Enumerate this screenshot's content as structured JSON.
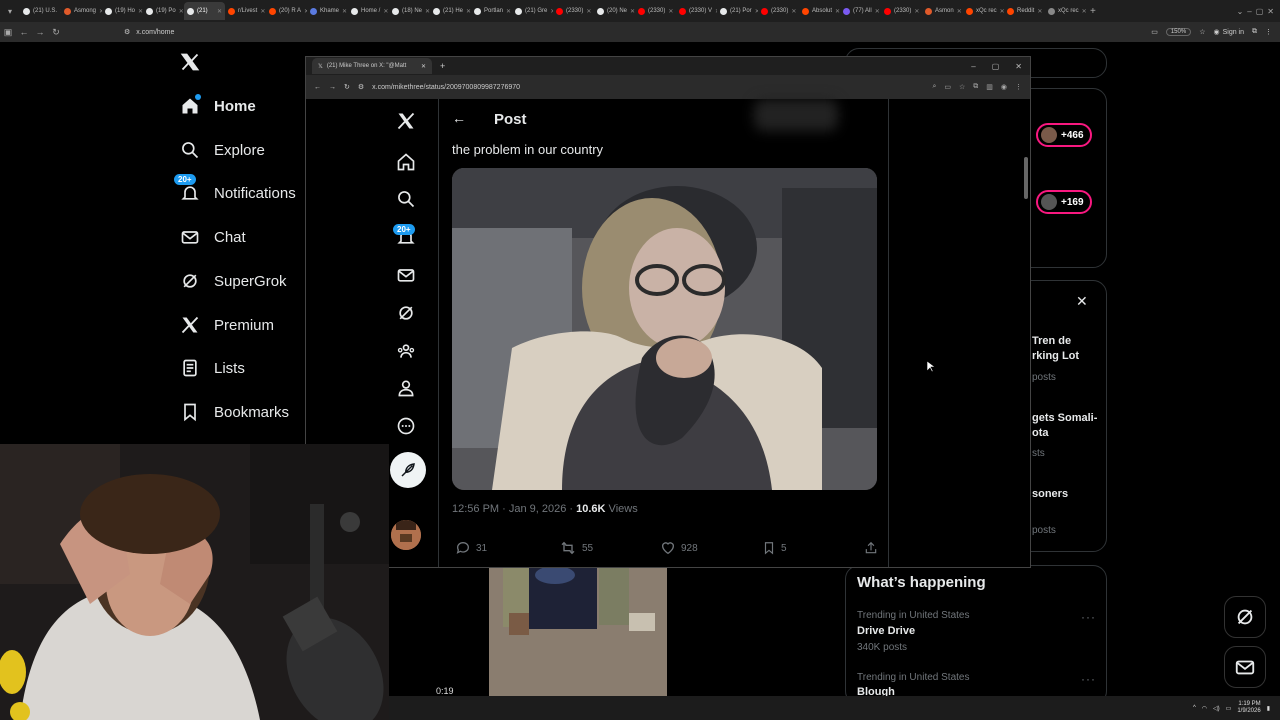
{
  "browser": {
    "tabs": [
      {
        "label": "(21) U.S.",
        "color": "#e7e9ea"
      },
      {
        "label": "Asmong",
        "color": "#e05a2a"
      },
      {
        "label": "(19) Ho",
        "color": "#e7e9ea"
      },
      {
        "label": "(19) Po",
        "color": "#e7e9ea"
      },
      {
        "label": "(21) ",
        "color": "#e7e9ea",
        "active": true
      },
      {
        "label": "r/Livest",
        "color": "#ff4500"
      },
      {
        "label": "(20) R A",
        "color": "#ff4500"
      },
      {
        "label": "Khame",
        "color": "#5a7ae0"
      },
      {
        "label": "Home /",
        "color": "#e7e9ea"
      },
      {
        "label": "(18) Ne",
        "color": "#e7e9ea"
      },
      {
        "label": "(21) He",
        "color": "#e7e9ea"
      },
      {
        "label": "Portlan",
        "color": "#e7e9ea"
      },
      {
        "label": "(21) Gre",
        "color": "#e7e9ea"
      },
      {
        "label": "(2330)",
        "color": "#ff0000"
      },
      {
        "label": "(20) Ne",
        "color": "#e7e9ea"
      },
      {
        "label": "(2330) ",
        "color": "#ff0000"
      },
      {
        "label": "(2330) V",
        "color": "#ff0000"
      },
      {
        "label": "(21) Por",
        "color": "#e7e9ea"
      },
      {
        "label": "(2330)",
        "color": "#ff0000"
      },
      {
        "label": "Absolut",
        "color": "#ff4500"
      },
      {
        "label": "(77) All",
        "color": "#7a5af0"
      },
      {
        "label": "(2330) ",
        "color": "#ff0000"
      },
      {
        "label": "Asmon",
        "color": "#e05a2a"
      },
      {
        "label": "xQc rec",
        "color": "#ff4500"
      },
      {
        "label": "Reddit",
        "color": "#ff4500"
      },
      {
        "label": "xQc rec",
        "color": "#888"
      }
    ],
    "url": "x.com/home",
    "zoom": "150%",
    "signin_label": "Sign in"
  },
  "x_nav": {
    "items": [
      {
        "label": "Home",
        "icon": "home-icon",
        "bold": true,
        "dot": true
      },
      {
        "label": "Explore",
        "icon": "search-icon"
      },
      {
        "label": "Notifications",
        "icon": "bell-icon",
        "badge": "20+"
      },
      {
        "label": "Chat",
        "icon": "mail-icon"
      },
      {
        "label": "SuperGrok",
        "icon": "grok-icon"
      },
      {
        "label": "Premium",
        "icon": "x-logo-icon"
      },
      {
        "label": "Lists",
        "icon": "list-icon"
      },
      {
        "label": "Bookmarks",
        "icon": "bookmark-icon"
      }
    ]
  },
  "right_column": {
    "pills": [
      "+466",
      "+169"
    ],
    "peek": [
      "Tren de",
      "rking Lot",
      "posts",
      "gets Somali-",
      "ota",
      "sts",
      "soners",
      "posts"
    ],
    "whats_happening_title": "What’s happening",
    "trends": [
      {
        "meta": "Trending in United States",
        "name": "Drive Drive",
        "count": "340K posts"
      },
      {
        "meta": "Trending in United States",
        "name": "Blough",
        "count": ""
      }
    ]
  },
  "bg_video_time": "0:19",
  "popup": {
    "tab_title": "(21) Mike Three on X: \"@Matt",
    "url": "x.com/mikethree/status/2009700809987276970",
    "side_badge": "20+",
    "post_header": "Post",
    "post_text": "the problem in our country",
    "meta_time": "12:56 PM · Jan 9, 2026 · ",
    "meta_views": "10.6K",
    "meta_views_label": " Views",
    "actions": {
      "replies": "31",
      "reposts": "55",
      "likes": "928",
      "bookmarks": "5"
    }
  },
  "taskbar": {
    "time": "1:19 PM",
    "date": "1/9/2026"
  },
  "colors": {
    "accent": "#1d9bf0",
    "pink": "#f91880",
    "bg": "#000000",
    "muted": "#71767b"
  }
}
